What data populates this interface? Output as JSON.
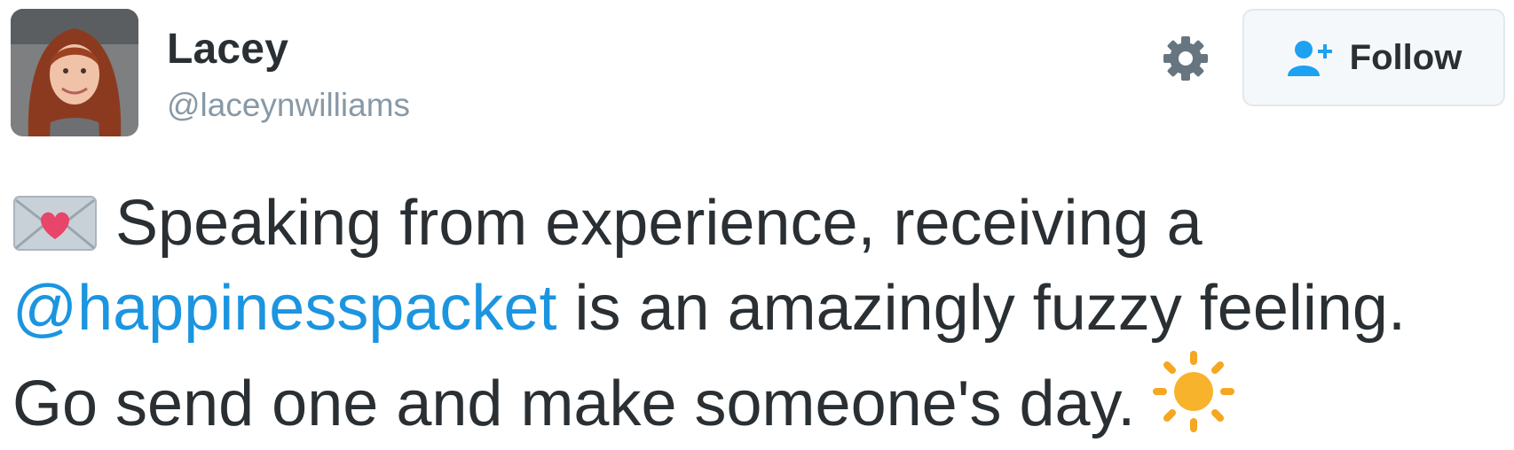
{
  "author": {
    "display_name": "Lacey",
    "screen_name": "@laceynwilliams",
    "avatar_icon": "profile-photo"
  },
  "actions": {
    "settings_icon": "gear-icon",
    "follow": {
      "icon": "add-user-icon",
      "label": "Follow"
    }
  },
  "tweet": {
    "line1_emoji": "love-letter-emoji",
    "line1_text": "Speaking from experience, receiving a",
    "line2_mention": "@happinesspacket",
    "line2_text": " is an amazingly fuzzy feeling.",
    "line3_text": "Go send one and make someone's day.",
    "line3_emoji": "sun-emoji"
  },
  "colors": {
    "text": "#292f33",
    "muted": "#8899a6",
    "link": "#1b95e0",
    "button_border": "#e1e8ed",
    "button_bg": "#f5f8fa",
    "gear": "#66757f"
  }
}
